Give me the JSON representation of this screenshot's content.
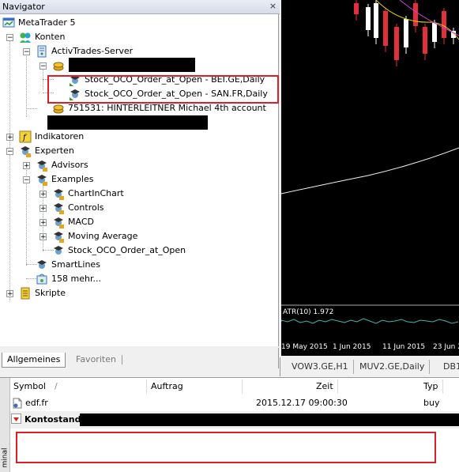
{
  "navigator": {
    "title": "Navigator",
    "close_glyph": "×",
    "tree": {
      "root": "MetaTrader 5",
      "konten": "Konten",
      "server": "ActivTrades-Server",
      "ea_1": "Stock_OCO_Order_at_Open - BEI.GE,Daily",
      "ea_2": "Stock_OCO_Order_at_Open - SAN.FR,Daily",
      "account_2": "751531: HINTERLEITNER Michael 4th account",
      "indikatoren": "Indikatoren",
      "experten": "Experten",
      "advisors": "Advisors",
      "examples": "Examples",
      "chartinchart": "ChartInChart",
      "controls": "Controls",
      "macd": "MACD",
      "moving_average": "Moving Average",
      "stock_oco": "Stock_OCO_Order_at_Open",
      "smartlines": "SmartLines",
      "more": "158 mehr...",
      "skripte": "Skripte"
    },
    "tabs": [
      "Allgemeines",
      "Favoriten"
    ]
  },
  "chart": {
    "indicator_label": "ATR(10) 1.972",
    "dates": [
      "19 May 2015",
      "1 Jun 2015",
      "11 Jun 2015",
      "23 Jun 2"
    ],
    "tabs": [
      "VOW3.GE,H1",
      "MUV2.GE,Daily",
      "DB1"
    ],
    "colors": {
      "background": "#000000",
      "bear_candle": "#e0303a",
      "bull_candle": "#ffffff",
      "ma_yellow": "#e8d000",
      "ma_magenta": "#d040d0",
      "atr_line": "#3fb7a8"
    }
  },
  "terminal": {
    "side_label": "minal",
    "columns": {
      "symbol": "Symbol",
      "auftrag": "Auftrag",
      "zeit": "Zeit",
      "typ": "Typ"
    },
    "sort_glyph": "/",
    "rows": [
      {
        "symbol": "edf.fr",
        "zeit": "2015.12.17 09:00:30",
        "typ": "buy"
      }
    ],
    "balance_label": "Kontostand:"
  },
  "colors": {
    "annotation_red": "#d9202a"
  }
}
